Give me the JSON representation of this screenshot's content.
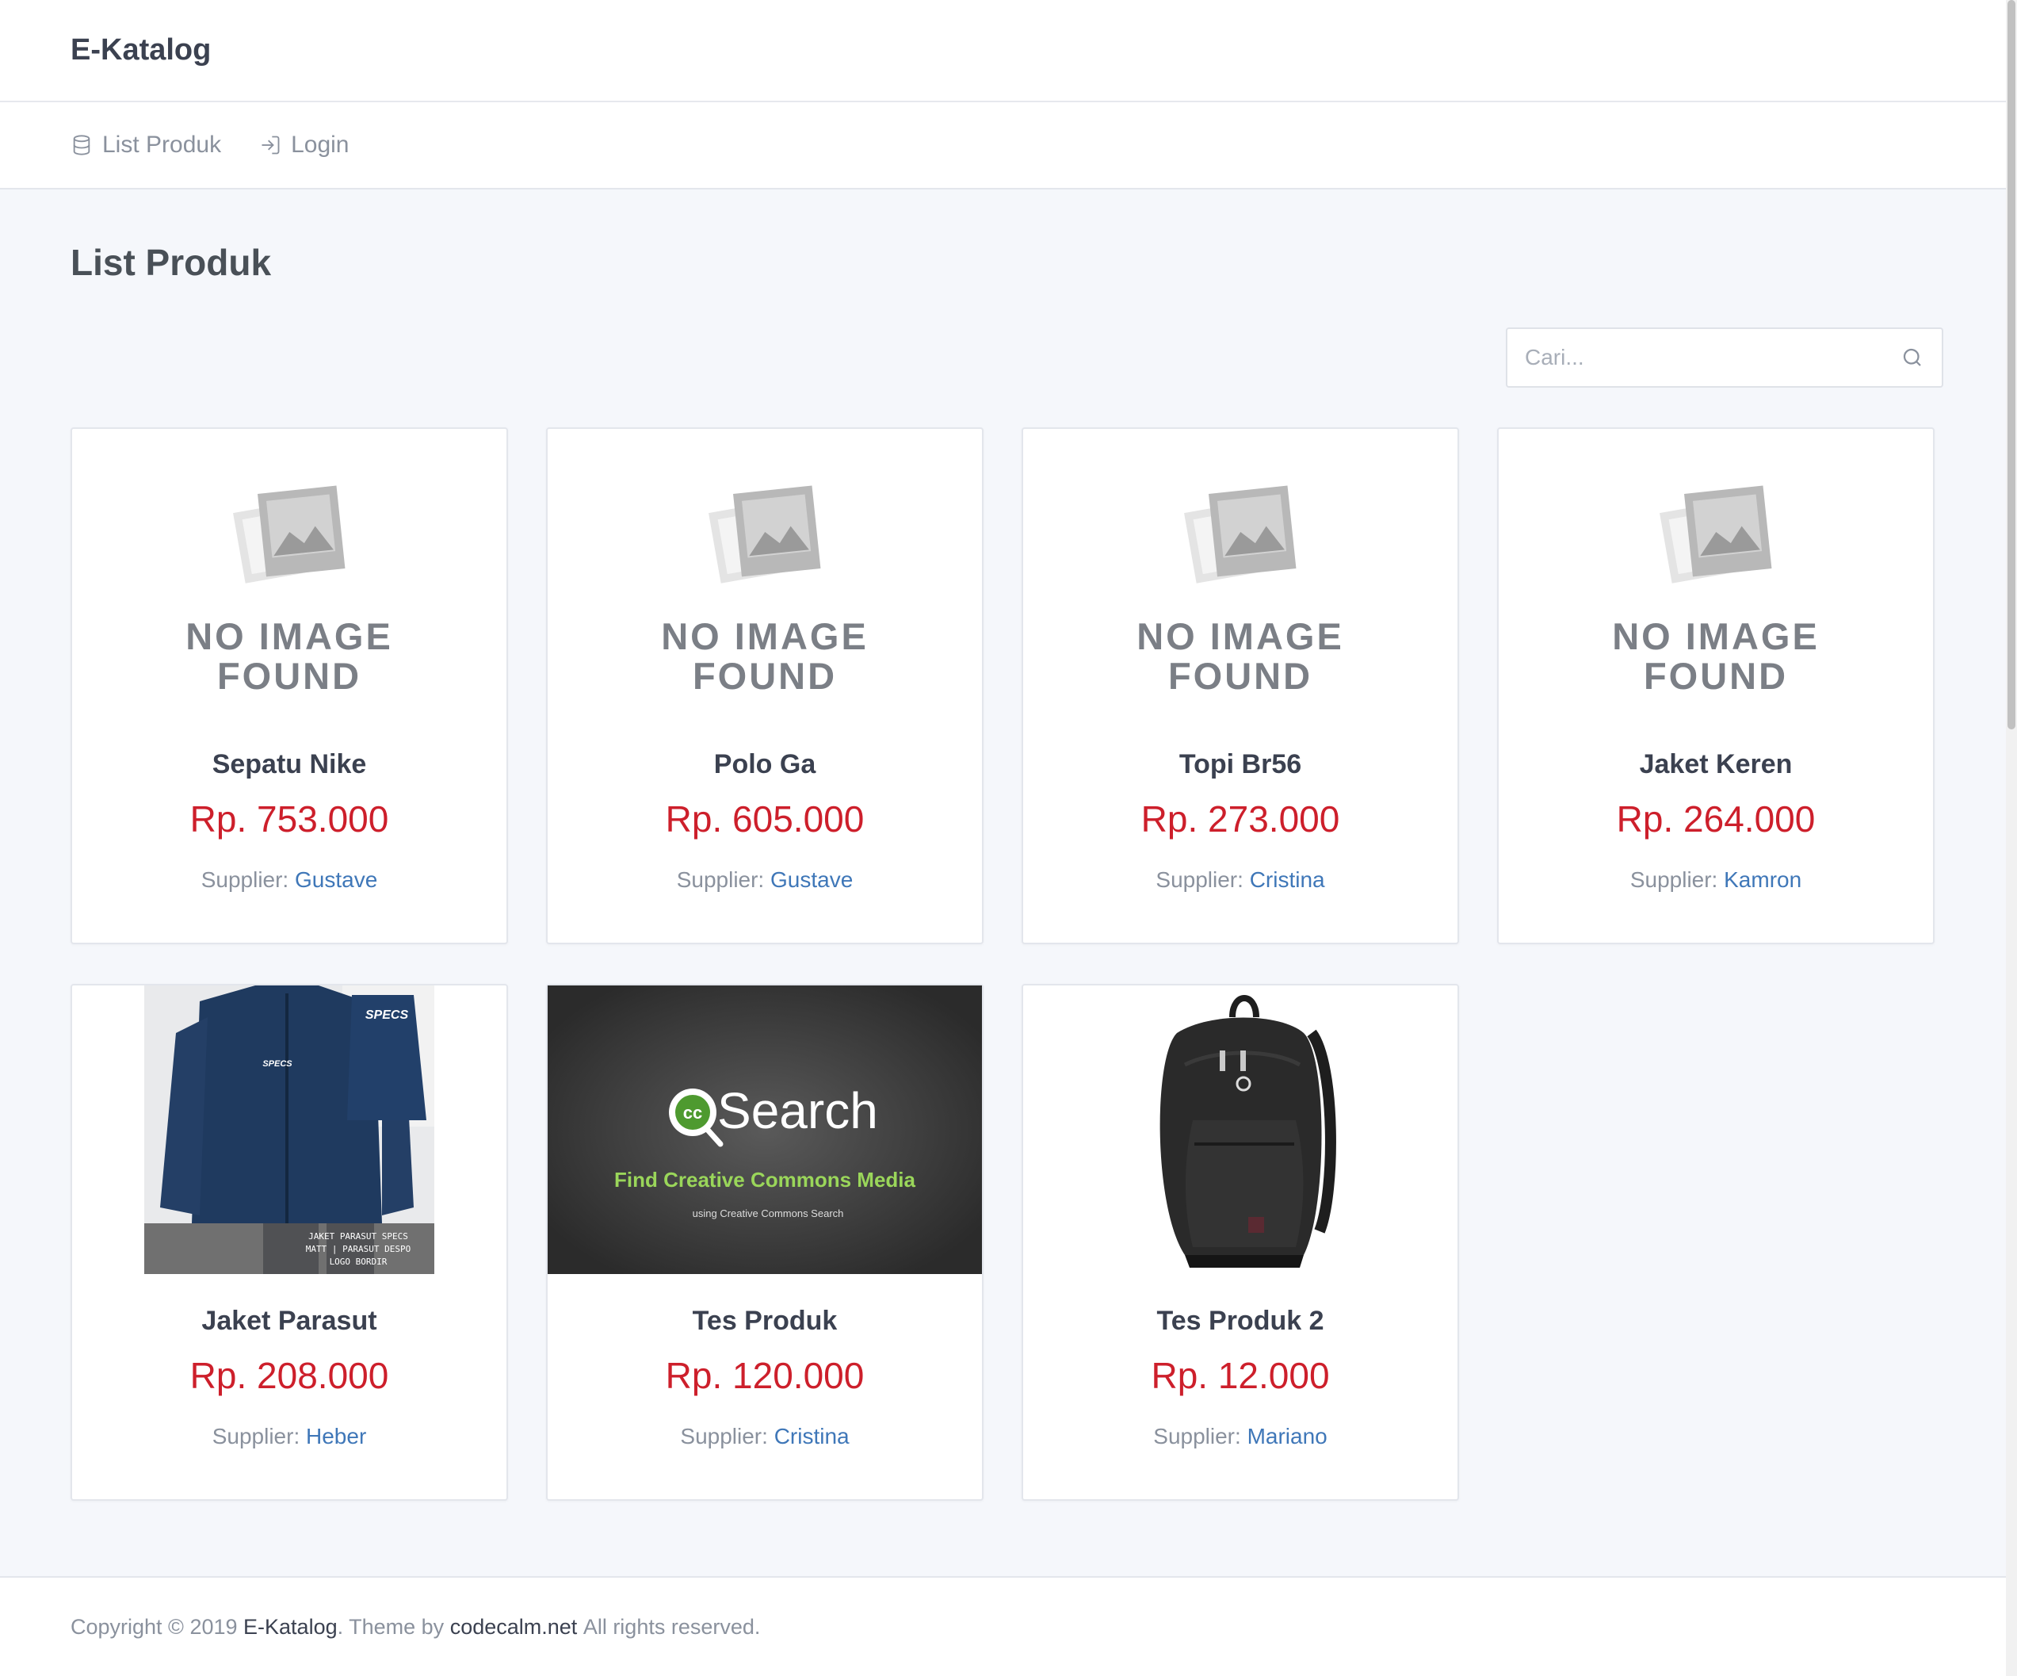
{
  "header": {
    "brand": "E-Katalog"
  },
  "nav": {
    "items": [
      {
        "label": "List Produk",
        "icon": "database-icon"
      },
      {
        "label": "Login",
        "icon": "login-icon"
      }
    ]
  },
  "main": {
    "title": "List Produk",
    "search": {
      "placeholder": "Cari...",
      "value": ""
    },
    "no_image_text": {
      "line1": "NO IMAGE",
      "line2": "FOUND"
    },
    "supplier_label": "Supplier:",
    "products": [
      {
        "name": "Sepatu Nike",
        "price": "Rp. 753.000",
        "supplier": "Gustave",
        "image": "no-image"
      },
      {
        "name": "Polo Ga",
        "price": "Rp. 605.000",
        "supplier": "Gustave",
        "image": "no-image"
      },
      {
        "name": "Topi Br56",
        "price": "Rp. 273.000",
        "supplier": "Cristina",
        "image": "no-image"
      },
      {
        "name": "Jaket Keren",
        "price": "Rp. 264.000",
        "supplier": "Kamron",
        "image": "no-image"
      },
      {
        "name": "Jaket Parasut",
        "price": "Rp. 208.000",
        "supplier": "Heber",
        "image": "jacket-photo",
        "image_caption": [
          "JAKET PARASUT SPECS",
          "MATT | PARASUT DESPO",
          "LOGO BORDIR"
        ],
        "image_logo": "SPECS"
      },
      {
        "name": "Tes Produk",
        "price": "Rp. 120.000",
        "supplier": "Cristina",
        "image": "cc-search-banner",
        "image_title": "Search",
        "image_cc": "cc",
        "image_subtitle": "Find Creative Commons Media",
        "image_small": "using Creative Commons Search"
      },
      {
        "name": "Tes Produk 2",
        "price": "Rp. 12.000",
        "supplier": "Mariano",
        "image": "backpack-photo"
      }
    ]
  },
  "footer": {
    "prefix": "Copyright © 2019",
    "brand": "E-Katalog",
    "theme_by": ". Theme by",
    "theme_link": "codecalm.net",
    "suffix": "All rights reserved."
  },
  "colors": {
    "price": "#cd1f2b",
    "link": "#3f77b8",
    "background": "#f5f7fb"
  }
}
